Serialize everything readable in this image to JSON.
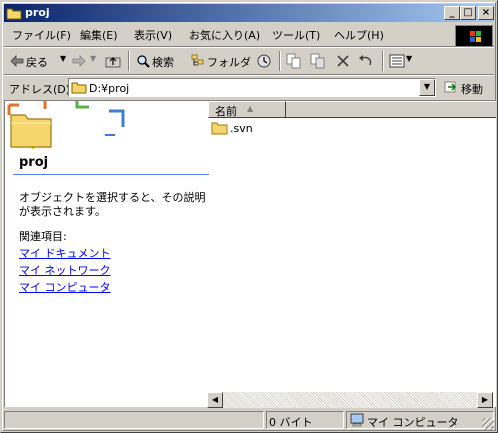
{
  "window": {
    "title": "proj",
    "controls": {
      "minimize": "_",
      "maximize": "□",
      "close": "×"
    }
  },
  "menu": {
    "items": [
      "ファイル(F)",
      "編集(E)",
      "表示(V)",
      "お気に入り(A)",
      "ツール(T)",
      "ヘルプ(H)"
    ]
  },
  "toolbar": {
    "back_label": "戻る",
    "search_label": "検索",
    "folders_label": "フォルダ",
    "icons": [
      "back-arrow-icon",
      "forward-arrow-icon",
      "up-folder-icon",
      "search-icon",
      "folders-icon",
      "history-icon",
      "move-to-icon",
      "copy-to-icon",
      "delete-icon",
      "undo-icon",
      "views-icon"
    ]
  },
  "address": {
    "label": "アドレス(D)",
    "value": "D:¥proj",
    "go_label": "移動"
  },
  "left_pane": {
    "folder_name": "proj",
    "description": "オブジェクトを選択すると、その説明が表示されます。",
    "related_heading": "関連項目:",
    "links": [
      "マイ ドキュメント",
      "マイ ネットワーク",
      "マイ コンピュータ"
    ]
  },
  "list": {
    "column_name": "名前",
    "files": [
      {
        "name": ".svn",
        "icon": "folder-icon"
      }
    ]
  },
  "statusbar": {
    "size": "0 バイト",
    "location": "マイ コンピュータ"
  },
  "colors": {
    "title_gradient_start": "#0a246a",
    "title_gradient_end": "#a6caf0",
    "chrome": "#d4d0c8",
    "link": "#0000ff"
  }
}
